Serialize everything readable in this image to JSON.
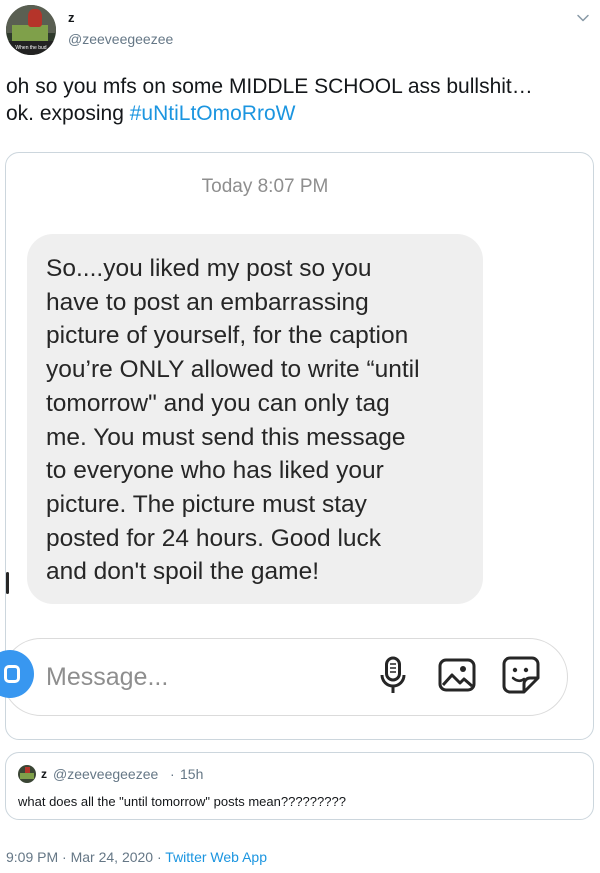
{
  "user": {
    "name": "z",
    "handle": "@zeeveegeezee",
    "avatar_caption": "When the bud"
  },
  "tweet": {
    "text_line1": "oh so you mfs on some MIDDLE SCHOOL ass bullshit…",
    "text_line2_prefix": "ok. exposing ",
    "hashtag": "#uNtiLtOmoRroW"
  },
  "screenshot": {
    "timestamp": "Today 8:07 PM",
    "message_lines": [
      "So....you liked my post so you",
      "have to post an embarrassing",
      "picture of yourself, for the caption",
      "you’re ONLY allowed to write “until",
      "tomorrow\" and you can only tag",
      "me.  You must send this message",
      "to everyone who has liked your",
      "picture.  The picture must stay",
      "posted for 24 hours.  Good luck",
      "and don't spoil the game!"
    ],
    "input_placeholder": "Message..."
  },
  "quoted_tweet": {
    "name": "z",
    "handle": "@zeeveegeezee",
    "separator": "·",
    "time": "15h",
    "text": "what does all the \"until tomorrow\" posts mean?????????"
  },
  "footer": {
    "time": "9:09 PM",
    "sep1": " · ",
    "date": "Mar 24, 2020",
    "sep2": " · ",
    "app": "Twitter Web App"
  },
  "icons": {
    "chevron": "chevron-down-icon",
    "camera": "camera-icon",
    "mic": "microphone-icon",
    "gallery": "image-icon",
    "sticker": "sticker-icon"
  },
  "colors": {
    "link": "#1b95e0",
    "secondary_text": "#657786",
    "bubble": "#efefef",
    "border": "#ccd6dd"
  }
}
